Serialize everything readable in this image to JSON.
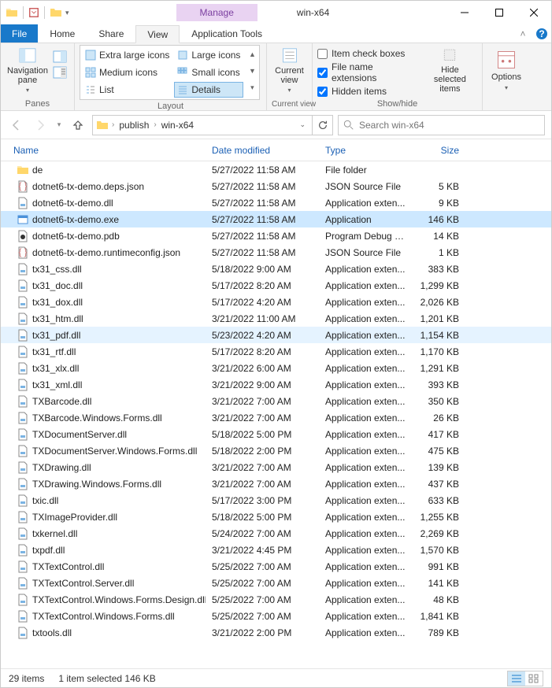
{
  "window": {
    "title": "win-x64",
    "context_tab": "Manage"
  },
  "tabs": {
    "file": "File",
    "home": "Home",
    "share": "Share",
    "view": "View",
    "app_tools": "Application Tools"
  },
  "ribbon": {
    "panes": {
      "nav_pane": "Navigation\npane",
      "group": "Panes"
    },
    "layout": {
      "group": "Layout",
      "extra_large": "Extra large icons",
      "large": "Large icons",
      "medium": "Medium icons",
      "small": "Small icons",
      "list": "List",
      "details": "Details"
    },
    "current_view": {
      "label": "Current\nview",
      "group": "Current view"
    },
    "show_hide": {
      "group": "Show/hide",
      "item_check": "Item check boxes",
      "file_ext": "File name extensions",
      "hidden": "Hidden items",
      "hide_selected": "Hide selected\nitems"
    },
    "options": "Options"
  },
  "address": {
    "crumbs": [
      "publish",
      "win-x64"
    ]
  },
  "search": {
    "placeholder": "Search win-x64"
  },
  "columns": {
    "name": "Name",
    "date": "Date modified",
    "type": "Type",
    "size": "Size"
  },
  "files": [
    {
      "icon": "folder",
      "name": "de",
      "date": "5/27/2022 11:58 AM",
      "type": "File folder",
      "size": ""
    },
    {
      "icon": "json",
      "name": "dotnet6-tx-demo.deps.json",
      "date": "5/27/2022 11:58 AM",
      "type": "JSON Source File",
      "size": "5 KB"
    },
    {
      "icon": "dll",
      "name": "dotnet6-tx-demo.dll",
      "date": "5/27/2022 11:58 AM",
      "type": "Application exten...",
      "size": "9 KB"
    },
    {
      "icon": "exe",
      "name": "dotnet6-tx-demo.exe",
      "date": "5/27/2022 11:58 AM",
      "type": "Application",
      "size": "146 KB",
      "selected": true
    },
    {
      "icon": "pdb",
      "name": "dotnet6-tx-demo.pdb",
      "date": "5/27/2022 11:58 AM",
      "type": "Program Debug D...",
      "size": "14 KB"
    },
    {
      "icon": "json",
      "name": "dotnet6-tx-demo.runtimeconfig.json",
      "date": "5/27/2022 11:58 AM",
      "type": "JSON Source File",
      "size": "1 KB"
    },
    {
      "icon": "dll",
      "name": "tx31_css.dll",
      "date": "5/18/2022 9:00 AM",
      "type": "Application exten...",
      "size": "383 KB"
    },
    {
      "icon": "dll",
      "name": "tx31_doc.dll",
      "date": "5/17/2022 8:20 AM",
      "type": "Application exten...",
      "size": "1,299 KB"
    },
    {
      "icon": "dll",
      "name": "tx31_dox.dll",
      "date": "5/17/2022 4:20 AM",
      "type": "Application exten...",
      "size": "2,026 KB"
    },
    {
      "icon": "dll",
      "name": "tx31_htm.dll",
      "date": "3/21/2022 11:00 AM",
      "type": "Application exten...",
      "size": "1,201 KB"
    },
    {
      "icon": "dll",
      "name": "tx31_pdf.dll",
      "date": "5/23/2022 4:20 AM",
      "type": "Application exten...",
      "size": "1,154 KB",
      "hover": true
    },
    {
      "icon": "dll",
      "name": "tx31_rtf.dll",
      "date": "5/17/2022 8:20 AM",
      "type": "Application exten...",
      "size": "1,170 KB"
    },
    {
      "icon": "dll",
      "name": "tx31_xlx.dll",
      "date": "3/21/2022 6:00 AM",
      "type": "Application exten...",
      "size": "1,291 KB"
    },
    {
      "icon": "dll",
      "name": "tx31_xml.dll",
      "date": "3/21/2022 9:00 AM",
      "type": "Application exten...",
      "size": "393 KB"
    },
    {
      "icon": "dll",
      "name": "TXBarcode.dll",
      "date": "3/21/2022 7:00 AM",
      "type": "Application exten...",
      "size": "350 KB"
    },
    {
      "icon": "dll",
      "name": "TXBarcode.Windows.Forms.dll",
      "date": "3/21/2022 7:00 AM",
      "type": "Application exten...",
      "size": "26 KB"
    },
    {
      "icon": "dll",
      "name": "TXDocumentServer.dll",
      "date": "5/18/2022 5:00 PM",
      "type": "Application exten...",
      "size": "417 KB"
    },
    {
      "icon": "dll",
      "name": "TXDocumentServer.Windows.Forms.dll",
      "date": "5/18/2022 2:00 PM",
      "type": "Application exten...",
      "size": "475 KB"
    },
    {
      "icon": "dll",
      "name": "TXDrawing.dll",
      "date": "3/21/2022 7:00 AM",
      "type": "Application exten...",
      "size": "139 KB"
    },
    {
      "icon": "dll",
      "name": "TXDrawing.Windows.Forms.dll",
      "date": "3/21/2022 7:00 AM",
      "type": "Application exten...",
      "size": "437 KB"
    },
    {
      "icon": "dll",
      "name": "txic.dll",
      "date": "5/17/2022 3:00 PM",
      "type": "Application exten...",
      "size": "633 KB"
    },
    {
      "icon": "dll",
      "name": "TXImageProvider.dll",
      "date": "5/18/2022 5:00 PM",
      "type": "Application exten...",
      "size": "1,255 KB"
    },
    {
      "icon": "dll",
      "name": "txkernel.dll",
      "date": "5/24/2022 7:00 AM",
      "type": "Application exten...",
      "size": "2,269 KB"
    },
    {
      "icon": "dll",
      "name": "txpdf.dll",
      "date": "3/21/2022 4:45 PM",
      "type": "Application exten...",
      "size": "1,570 KB"
    },
    {
      "icon": "dll",
      "name": "TXTextControl.dll",
      "date": "5/25/2022 7:00 AM",
      "type": "Application exten...",
      "size": "991 KB"
    },
    {
      "icon": "dll",
      "name": "TXTextControl.Server.dll",
      "date": "5/25/2022 7:00 AM",
      "type": "Application exten...",
      "size": "141 KB"
    },
    {
      "icon": "dll",
      "name": "TXTextControl.Windows.Forms.Design.dll",
      "date": "5/25/2022 7:00 AM",
      "type": "Application exten...",
      "size": "48 KB"
    },
    {
      "icon": "dll",
      "name": "TXTextControl.Windows.Forms.dll",
      "date": "5/25/2022 7:00 AM",
      "type": "Application exten...",
      "size": "1,841 KB"
    },
    {
      "icon": "dll",
      "name": "txtools.dll",
      "date": "3/21/2022 2:00 PM",
      "type": "Application exten...",
      "size": "789 KB"
    }
  ],
  "status": {
    "count": "29 items",
    "selection": "1 item selected  146 KB"
  },
  "checks": {
    "item_check": false,
    "file_ext": true,
    "hidden": true
  }
}
